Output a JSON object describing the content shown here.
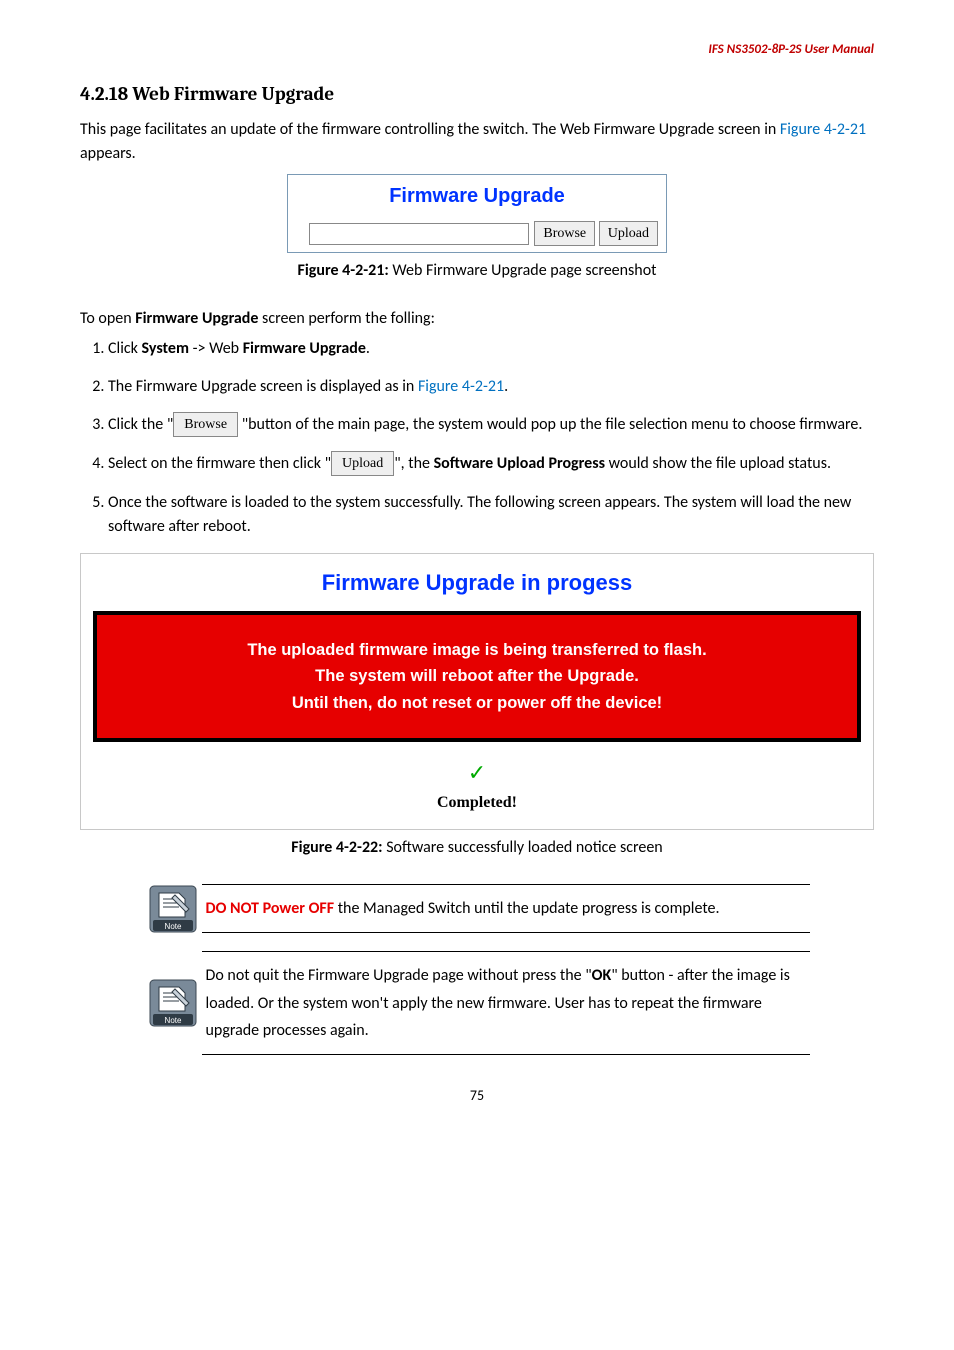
{
  "header": {
    "product": "IFS  NS3502-8P-2S  User  Manual"
  },
  "section": {
    "title": "4.2.18 Web Firmware Upgrade"
  },
  "intro": {
    "p1a": "This page facilitates an update of the firmware controlling the switch. The Web Firmware Upgrade screen in ",
    "link1": "Figure 4-2-21",
    "p1b": " appears."
  },
  "figure1": {
    "title": "Firmware Upgrade",
    "browse": "Browse",
    "upload": "Upload",
    "caption_b": "Figure 4-2-21:",
    "caption_rest": " Web Firmware Upgrade page screenshot"
  },
  "open_line": {
    "a": "To open ",
    "b": "Firmware Upgrade",
    "c": " screen perform the folling:"
  },
  "steps": {
    "s1": {
      "a": "Click ",
      "b": "System",
      "c": " -> Web ",
      "d": "Firmware Upgrade",
      "e": "."
    },
    "s2": {
      "a": "The Firmware Upgrade screen is displayed as in ",
      "link": "Figure 4-2-21",
      "b": "."
    },
    "s3": {
      "a": "Click the \"",
      "btn": "Browse",
      "b": " \"button of the main page, the system would pop up the file selection menu to choose firmware."
    },
    "s4": {
      "a": "Select on the firmware then click \"",
      "btn": "Upload",
      "b": "\", the ",
      "bold": "Software Upload Progress",
      "c": " would show the file upload status."
    },
    "s5": {
      "a": "Once the software is loaded to the system successfully. The following screen appears. The system will load the new software after reboot."
    }
  },
  "progress": {
    "title": "Firmware Upgrade in progess",
    "l1": "The uploaded firmware image is being transferred to flash.",
    "l2": "The system will reboot after the Upgrade.",
    "l3": "Until then, do not reset or power off the device!",
    "check": "✓",
    "completed": "Completed!"
  },
  "figure2": {
    "caption_b": "Figure 4-2-22:",
    "caption_rest": " Software successfully loaded notice screen"
  },
  "note1": {
    "icon_label": "Note",
    "red": "DO NOT Power OFF",
    "rest": " the Managed Switch until the update progress is complete."
  },
  "note2": {
    "icon_label": "Note",
    "a": "Do not quit the Firmware Upgrade page without press the \"",
    "ok": "OK",
    "b": "\" button - after the image is loaded. Or the system won't apply the new firmware. User has to repeat the firmware upgrade processes again."
  },
  "page": {
    "num": "75"
  }
}
